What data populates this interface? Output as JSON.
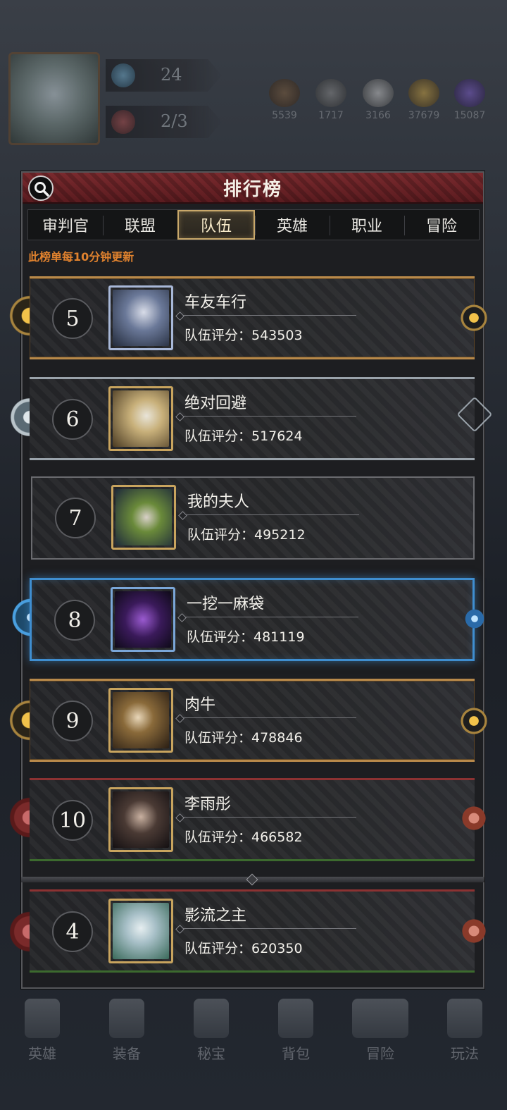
{
  "hud": {
    "level": "24",
    "stamina": "2/3",
    "resources": [
      "5539",
      "1717",
      "3166",
      "37679",
      "15087"
    ]
  },
  "panel": {
    "title": "排行榜",
    "tabs": [
      {
        "label": "审判官",
        "active": false
      },
      {
        "label": "联盟",
        "active": false
      },
      {
        "label": "队伍",
        "active": true
      },
      {
        "label": "英雄",
        "active": false
      },
      {
        "label": "职业",
        "active": false
      },
      {
        "label": "冒险",
        "active": false
      }
    ],
    "notice": "此榜单每10分钟更新"
  },
  "score_prefix": "队伍评分:",
  "rows": [
    {
      "rank": "5",
      "name": "车友车行",
      "score": "队伍评分：543503"
    },
    {
      "rank": "6",
      "name": "绝对回避",
      "score": "队伍评分：517624"
    },
    {
      "rank": "7",
      "name": "我的夫人",
      "score": "队伍评分：495212"
    },
    {
      "rank": "8",
      "name": "一挖一麻袋",
      "score": "队伍评分：481119"
    },
    {
      "rank": "9",
      "name": "肉牛",
      "score": "队伍评分：478846"
    },
    {
      "rank": "10",
      "name": "李雨彤",
      "score": "队伍评分：466582"
    }
  ],
  "my_row": {
    "rank": "4",
    "name": "影流之主",
    "score": "队伍评分：620350"
  },
  "bottom_nav": [
    "英雄",
    "装备",
    "秘宝",
    "背包",
    "冒险",
    "玩法"
  ],
  "colors": {
    "header_red": "#6a2226",
    "accent_gold": "#c9a86a",
    "notice_orange": "#e0822e",
    "rank8_blue": "#3f8ed0"
  }
}
